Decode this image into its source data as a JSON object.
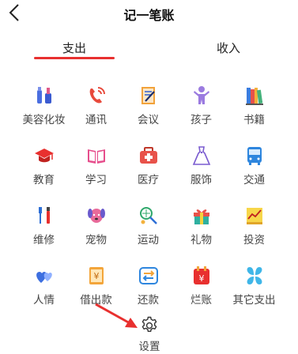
{
  "header": {
    "title": "记一笔账"
  },
  "tabs": [
    {
      "label": "支出"
    },
    {
      "label": "收入"
    }
  ],
  "categories": [
    {
      "label": "美容化妆",
      "icon": "cosmetics-icon"
    },
    {
      "label": "通讯",
      "icon": "phone-icon"
    },
    {
      "label": "会议",
      "icon": "meeting-icon"
    },
    {
      "label": "孩子",
      "icon": "child-icon"
    },
    {
      "label": "书籍",
      "icon": "books-icon"
    },
    {
      "label": "教育",
      "icon": "graduation-cap-icon"
    },
    {
      "label": "学习",
      "icon": "study-book-icon"
    },
    {
      "label": "医疗",
      "icon": "medical-kit-icon"
    },
    {
      "label": "服饰",
      "icon": "dress-icon"
    },
    {
      "label": "交通",
      "icon": "bus-icon"
    },
    {
      "label": "维修",
      "icon": "repair-tools-icon"
    },
    {
      "label": "宠物",
      "icon": "pet-dog-icon"
    },
    {
      "label": "运动",
      "icon": "badminton-icon"
    },
    {
      "label": "礼物",
      "icon": "gift-icon"
    },
    {
      "label": "投资",
      "icon": "investment-chart-icon"
    },
    {
      "label": "人情",
      "icon": "hearts-icon"
    },
    {
      "label": "借出款",
      "icon": "loan-icon"
    },
    {
      "label": "还款",
      "icon": "repay-icon"
    },
    {
      "label": "烂账",
      "icon": "bad-debt-icon"
    },
    {
      "label": "其它支出",
      "icon": "other-expense-icon"
    }
  ],
  "settings": {
    "label": "设置",
    "icon": "gear-icon"
  },
  "colors": {
    "accent": "#e8302f",
    "arrow": "#e8302f"
  }
}
